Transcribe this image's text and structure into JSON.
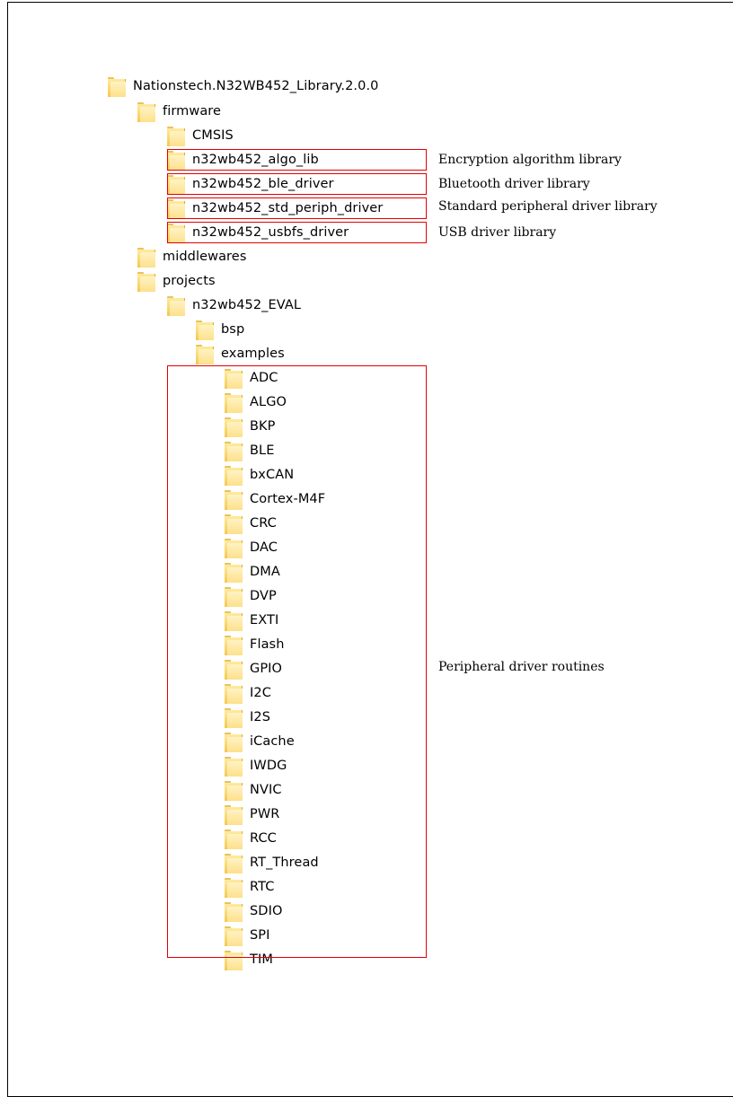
{
  "tree": {
    "root": {
      "label": "Nationstech.N32WB452_Library.2.0.0",
      "icon": "folder-icon"
    },
    "firmware": {
      "label": "firmware",
      "children": [
        {
          "label": "CMSIS"
        },
        {
          "label": "n32wb452_algo_lib"
        },
        {
          "label": "n32wb452_ble_driver"
        },
        {
          "label": "n32wb452_std_periph_driver"
        },
        {
          "label": "n32wb452_usbfs_driver"
        }
      ]
    },
    "middlewares": {
      "label": "middlewares"
    },
    "projects": {
      "label": "projects",
      "eval": {
        "label": "n32wb452_EVAL",
        "bsp": {
          "label": "bsp"
        },
        "examples": {
          "label": "examples",
          "children": [
            "ADC",
            "ALGO",
            "BKP",
            "BLE",
            "bxCAN",
            "Cortex-M4F",
            "CRC",
            "DAC",
            "DMA",
            "DVP",
            "EXTI",
            "Flash",
            "GPIO",
            "I2C",
            "I2S",
            "iCache",
            "IWDG",
            "NVIC",
            "PWR",
            "RCC",
            "RT_Thread",
            "RTC",
            "SDIO",
            "SPI",
            "TIM"
          ]
        }
      }
    }
  },
  "annotations": {
    "algo_lib": "Encryption algorithm library",
    "ble_driver": "Bluetooth driver library",
    "std_periph_driver": "Standard peripheral driver library",
    "usbfs_driver": "USB driver library",
    "examples": "Peripheral driver routines"
  },
  "colors": {
    "highlight": "#e30000",
    "folder": "#fbd86e",
    "text": "#000000"
  }
}
